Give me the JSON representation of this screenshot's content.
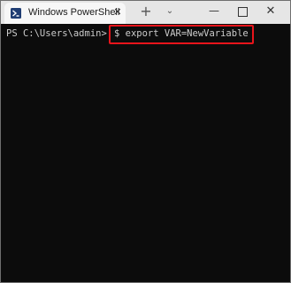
{
  "window": {
    "tab_title": "Windows PowerShell",
    "tab_close": "✕",
    "new_tab": "+",
    "dropdown": "⌄",
    "minimize": "—",
    "close": "✕"
  },
  "terminal": {
    "prompt": "PS C:\\Users\\admin>",
    "command": "$ export VAR=NewVariable",
    "highlight_color": "#e8141b"
  },
  "icons": {
    "tab_icon": "powershell-icon",
    "new_tab": "plus-icon",
    "dropdown": "chevron-down-icon",
    "minimize": "minimize-icon",
    "maximize": "maximize-icon",
    "close": "close-icon"
  }
}
